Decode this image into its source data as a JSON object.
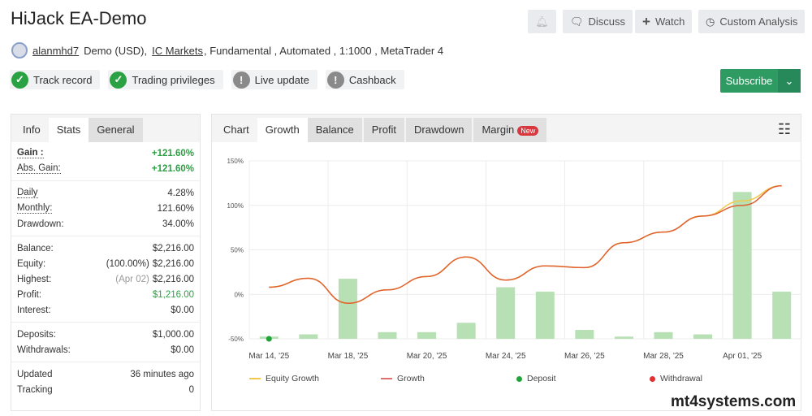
{
  "header": {
    "title": "HiJack EA-Demo",
    "buttons": {
      "discuss": "Discuss",
      "watch": "Watch",
      "custom": "Custom Analysis"
    },
    "user": "alanmhd7",
    "account": "Demo (USD),",
    "broker": "IC Markets",
    "details": ", Fundamental , Automated , 1:1000 , MetaTrader 4"
  },
  "badges": [
    {
      "label": "Track record",
      "status": "ok"
    },
    {
      "label": "Trading privileges",
      "status": "ok"
    },
    {
      "label": "Live update",
      "status": "warn"
    },
    {
      "label": "Cashback",
      "status": "warn"
    }
  ],
  "subscribe": "Subscribe",
  "left_tabs": [
    "Info",
    "Stats",
    "General"
  ],
  "stats": {
    "gain": {
      "label": "Gain :",
      "value": "+121.60%"
    },
    "abs_gain": {
      "label": "Abs. Gain:",
      "value": "+121.60%"
    },
    "daily": {
      "label": "Daily",
      "value": "4.28%"
    },
    "monthly": {
      "label": "Monthly:",
      "value": "121.60%"
    },
    "drawdown": {
      "label": "Drawdown:",
      "value": "34.00%"
    },
    "balance": {
      "label": "Balance:",
      "value": "$2,216.00"
    },
    "equity": {
      "label": "Equity:",
      "note": "(100.00%)",
      "value": "$2,216.00"
    },
    "highest": {
      "label": "Highest:",
      "note": "(Apr 02)",
      "value": "$2,216.00"
    },
    "profit": {
      "label": "Profit:",
      "value": "$1,216.00"
    },
    "interest": {
      "label": "Interest:",
      "value": "$0.00"
    },
    "deposits": {
      "label": "Deposits:",
      "value": "$1,000.00"
    },
    "withdrawals": {
      "label": "Withdrawals:",
      "value": "$0.00"
    },
    "updated": {
      "label": "Updated",
      "value": "36 minutes ago"
    },
    "tracking": {
      "label": "Tracking",
      "value": "0"
    }
  },
  "chart_tabs": {
    "chart": "Chart",
    "growth": "Growth",
    "balance": "Balance",
    "profit": "Profit",
    "drawdown": "Drawdown",
    "margin": "Margin",
    "new": "New"
  },
  "watermark": "mt4systems.com",
  "chart_data": {
    "type": "bar+line",
    "ylim": [
      -50,
      150
    ],
    "yticks": [
      "150%",
      "100%",
      "50%",
      "0%",
      "-50%"
    ],
    "ytick_values": [
      150,
      100,
      50,
      0,
      -50
    ],
    "xtick_labels": [
      "Mar 14, '25",
      "Mar 18, '25",
      "Mar 20, '25",
      "Mar 24, '25",
      "Mar 26, '25",
      "Mar 28, '25",
      "Apr 01, '25"
    ],
    "xtick_index": [
      0,
      2,
      4,
      6,
      8,
      10,
      12
    ],
    "bars": [
      -47.5,
      -45,
      17.5,
      -42.5,
      -42.5,
      -32,
      8,
      3,
      -40,
      -47.5,
      -42.5,
      -45,
      115,
      3
    ],
    "series": [
      {
        "name": "Equity Growth",
        "color": "#f2c94c",
        "values": [
          8,
          18,
          -10,
          5,
          20,
          42,
          16,
          32,
          30,
          58,
          70,
          88,
          105,
          122
        ]
      },
      {
        "name": "Growth",
        "color": "#e06030",
        "values": [
          8,
          18,
          -10,
          5,
          20,
          42,
          16,
          32,
          30,
          58,
          70,
          88,
          100,
          122
        ]
      }
    ],
    "deposit_points": [
      0
    ],
    "legend": [
      {
        "name": "Equity Growth",
        "color": "#f2c94c"
      },
      {
        "name": "Growth",
        "color": "#e07070"
      },
      {
        "name": "Deposit",
        "color": "#22a33a"
      },
      {
        "name": "Withdrawal",
        "color": "#e03030"
      }
    ],
    "legend_position": "bottom"
  }
}
